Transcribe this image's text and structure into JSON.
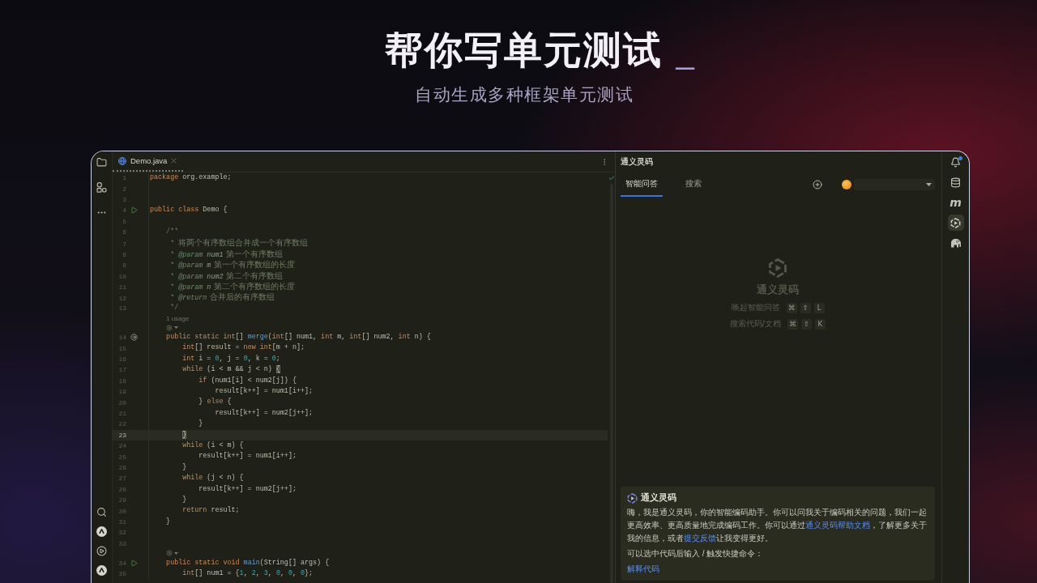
{
  "header": {
    "title": "帮你写单元测试",
    "cursor": "_",
    "subtitle": "自动生成多种框架单元测试"
  },
  "editor": {
    "tabs": [
      {
        "label": "Demo.java",
        "selected": true
      }
    ],
    "lines": [
      {
        "kind": "code",
        "number": "1",
        "current": false,
        "tokens": [
          {
            "kind": "keyword",
            "text": "package"
          },
          {
            "kind": "plain",
            "text": " org.example;"
          }
        ]
      },
      {
        "kind": "code",
        "number": "2",
        "current": false
      },
      {
        "kind": "code",
        "number": "3",
        "current": false
      },
      {
        "kind": "code",
        "number": "4",
        "current": false,
        "run_marker": true,
        "tokens": [
          {
            "kind": "keyword",
            "text": "public class"
          },
          {
            "kind": "plain",
            "text": " Demo {"
          }
        ]
      },
      {
        "kind": "code",
        "number": "5",
        "current": false
      },
      {
        "kind": "code",
        "number": "6",
        "current": false,
        "tokens": [
          {
            "kind": "comment",
            "text": "    /**"
          }
        ]
      },
      {
        "kind": "code",
        "number": "7",
        "current": false,
        "tokens": [
          {
            "kind": "comment",
            "text": "     * "
          },
          {
            "kind": "doc_text",
            "text": "将两个有序数组合并成一个有序数组"
          }
        ]
      },
      {
        "kind": "code",
        "number": "8",
        "current": false,
        "tokens": [
          {
            "kind": "comment",
            "text": "     * "
          },
          {
            "kind": "doctag",
            "text": "@param"
          },
          {
            "kind": "docparam",
            "text": " num1"
          },
          {
            "kind": "doc_text",
            "text": " 第一个有序数组"
          }
        ]
      },
      {
        "kind": "code",
        "number": "9",
        "current": false,
        "tokens": [
          {
            "kind": "comment",
            "text": "     * "
          },
          {
            "kind": "doctag",
            "text": "@param"
          },
          {
            "kind": "docparam",
            "text": " m"
          },
          {
            "kind": "doc_text",
            "text": " 第一个有序数组的长度"
          }
        ]
      },
      {
        "kind": "code",
        "number": "10",
        "current": false,
        "tokens": [
          {
            "kind": "comment",
            "text": "     * "
          },
          {
            "kind": "doctag",
            "text": "@param"
          },
          {
            "kind": "docparam",
            "text": " num2"
          },
          {
            "kind": "doc_text",
            "text": " 第二个有序数组"
          }
        ]
      },
      {
        "kind": "code",
        "number": "11",
        "current": false,
        "tokens": [
          {
            "kind": "comment",
            "text": "     * "
          },
          {
            "kind": "doctag",
            "text": "@param"
          },
          {
            "kind": "docparam",
            "text": " n"
          },
          {
            "kind": "doc_text",
            "text": " 第二个有序数组的长度"
          }
        ]
      },
      {
        "kind": "code",
        "number": "12",
        "current": false,
        "tokens": [
          {
            "kind": "comment",
            "text": "     * "
          },
          {
            "kind": "doctag",
            "text": "@return"
          },
          {
            "kind": "doc_text",
            "text": " 合并后的有序数组"
          }
        ]
      },
      {
        "kind": "code",
        "number": "13",
        "current": false,
        "tokens": [
          {
            "kind": "comment",
            "text": "     */"
          }
        ]
      },
      {
        "kind": "inlay",
        "text": "1 usage"
      },
      {
        "kind": "inlay_icon"
      },
      {
        "kind": "code",
        "number": "14",
        "current": false,
        "at_marker": true,
        "tokens": [
          {
            "kind": "keyword",
            "text": "    public static int"
          },
          {
            "kind": "plain",
            "text": "[] "
          },
          {
            "kind": "method",
            "text": "merge"
          },
          {
            "kind": "plain",
            "text": "("
          },
          {
            "kind": "keyword",
            "text": "int"
          },
          {
            "kind": "plain",
            "text": "[] num1, "
          },
          {
            "kind": "keyword",
            "text": "int"
          },
          {
            "kind": "plain",
            "text": " m, "
          },
          {
            "kind": "keyword",
            "text": "int"
          },
          {
            "kind": "plain",
            "text": "[] num2, "
          },
          {
            "kind": "keyword",
            "text": "int"
          },
          {
            "kind": "plain",
            "text": " n) {"
          }
        ]
      },
      {
        "kind": "code",
        "number": "15",
        "current": false,
        "tokens": [
          {
            "kind": "keyword",
            "text": "        int"
          },
          {
            "kind": "plain",
            "text": "[] result = "
          },
          {
            "kind": "keyword",
            "text": "new int"
          },
          {
            "kind": "plain",
            "text": "[m + n];"
          }
        ]
      },
      {
        "kind": "code",
        "number": "16",
        "current": false,
        "tokens": [
          {
            "kind": "keyword",
            "text": "        int"
          },
          {
            "kind": "plain",
            "text": " i = "
          },
          {
            "kind": "number",
            "text": "0"
          },
          {
            "kind": "plain",
            "text": ", j = "
          },
          {
            "kind": "number",
            "text": "0"
          },
          {
            "kind": "plain",
            "text": ", k = "
          },
          {
            "kind": "number",
            "text": "0"
          },
          {
            "kind": "plain",
            "text": ";"
          }
        ]
      },
      {
        "kind": "code",
        "number": "17",
        "current": false,
        "tokens": [
          {
            "kind": "keyword",
            "text": "        while"
          },
          {
            "kind": "plain",
            "text": " (i < m && j < n) "
          },
          {
            "kind": "match",
            "text": "{"
          }
        ]
      },
      {
        "kind": "code",
        "number": "18",
        "current": false,
        "tokens": [
          {
            "kind": "keyword",
            "text": "            if"
          },
          {
            "kind": "plain",
            "text": " (num1[i] < num2[j]) {"
          }
        ]
      },
      {
        "kind": "code",
        "number": "19",
        "current": false,
        "tokens": [
          {
            "kind": "plain",
            "text": "                result[k++] = num1[i++];"
          }
        ]
      },
      {
        "kind": "code",
        "number": "20",
        "current": false,
        "tokens": [
          {
            "kind": "plain",
            "text": "            } "
          },
          {
            "kind": "keyword",
            "text": "else"
          },
          {
            "kind": "plain",
            "text": " {"
          }
        ]
      },
      {
        "kind": "code",
        "number": "21",
        "current": false,
        "tokens": [
          {
            "kind": "plain",
            "text": "                result[k++] = num2[j++];"
          }
        ]
      },
      {
        "kind": "code",
        "number": "22",
        "current": false,
        "tokens": [
          {
            "kind": "plain",
            "text": "            }"
          }
        ]
      },
      {
        "kind": "code",
        "number": "23",
        "current": true,
        "tokens": [
          {
            "kind": "match",
            "text": "        }"
          }
        ]
      },
      {
        "kind": "code",
        "number": "24",
        "current": false,
        "tokens": [
          {
            "kind": "keyword",
            "text": "        while"
          },
          {
            "kind": "plain",
            "text": " (i < m) {"
          }
        ]
      },
      {
        "kind": "code",
        "number": "25",
        "current": false,
        "tokens": [
          {
            "kind": "plain",
            "text": "            result[k++] = num1[i++];"
          }
        ]
      },
      {
        "kind": "code",
        "number": "26",
        "current": false,
        "tokens": [
          {
            "kind": "plain",
            "text": "        }"
          }
        ]
      },
      {
        "kind": "code",
        "number": "27",
        "current": false,
        "tokens": [
          {
            "kind": "keyword",
            "text": "        while"
          },
          {
            "kind": "plain",
            "text": " (j < n) {"
          }
        ]
      },
      {
        "kind": "code",
        "number": "28",
        "current": false,
        "tokens": [
          {
            "kind": "plain",
            "text": "            result[k++] = num2[j++];"
          }
        ]
      },
      {
        "kind": "code",
        "number": "29",
        "current": false,
        "tokens": [
          {
            "kind": "plain",
            "text": "        }"
          }
        ]
      },
      {
        "kind": "code",
        "number": "30",
        "current": false,
        "tokens": [
          {
            "kind": "keyword",
            "text": "        return"
          },
          {
            "kind": "plain",
            "text": " result;"
          }
        ]
      },
      {
        "kind": "code",
        "number": "31",
        "current": false,
        "tokens": [
          {
            "kind": "plain",
            "text": "    }"
          }
        ]
      },
      {
        "kind": "code",
        "number": "32",
        "current": false
      },
      {
        "kind": "code",
        "number": "33",
        "current": false
      },
      {
        "kind": "inlay_icon"
      },
      {
        "kind": "code",
        "number": "34",
        "current": false,
        "run_marker": true,
        "tokens": [
          {
            "kind": "keyword",
            "text": "    public static void"
          },
          {
            "kind": "method",
            "text": " main"
          },
          {
            "kind": "plain",
            "text": "(String[] args) {"
          }
        ]
      },
      {
        "kind": "code",
        "number": "35",
        "current": false,
        "tokens": [
          {
            "kind": "keyword",
            "text": "        int"
          },
          {
            "kind": "plain",
            "text": "[] num1 = {"
          },
          {
            "kind": "number",
            "text": "1"
          },
          {
            "kind": "plain",
            "text": ", "
          },
          {
            "kind": "number",
            "text": "2"
          },
          {
            "kind": "plain",
            "text": ", "
          },
          {
            "kind": "number",
            "text": "3"
          },
          {
            "kind": "plain",
            "text": ", "
          },
          {
            "kind": "number",
            "text": "0"
          },
          {
            "kind": "plain",
            "text": ", "
          },
          {
            "kind": "number",
            "text": "0"
          },
          {
            "kind": "plain",
            "text": ", "
          },
          {
            "kind": "number",
            "text": "0"
          },
          {
            "kind": "plain",
            "text": "};"
          }
        ]
      }
    ]
  },
  "assistant": {
    "title": "通义灵码",
    "tabs": [
      {
        "label": "智能问答",
        "selected": true
      },
      {
        "label": "搜索",
        "selected": false
      }
    ],
    "welcome": {
      "name": "通义灵码",
      "shortcuts": [
        {
          "label": "唤起智能问答",
          "keys": [
            "⌘",
            "⇧",
            "L"
          ]
        },
        {
          "label": "搜索代码/文档",
          "keys": [
            "⌘",
            "⇧",
            "K"
          ]
        }
      ]
    },
    "message": {
      "sender": "通义灵码",
      "paragraphs": [
        {
          "segments": [
            {
              "kind": "text",
              "text": "嗨，我是通义灵码，你的智能编码助手。你可以问我关于编码相关的问题，我们一起更高效率、更高质量地完成编码工作。你可以通过"
            },
            {
              "kind": "link",
              "text": "通义灵码帮助文档"
            },
            {
              "kind": "text",
              "text": "，了解更多关于我的信息，或者"
            },
            {
              "kind": "link",
              "text": "提交反馈"
            },
            {
              "kind": "text",
              "text": "让我变得更好。"
            }
          ]
        },
        {
          "segments": [
            {
              "kind": "text",
              "text": "可以选中代码后输入 / 触发快捷命令："
            }
          ]
        }
      ],
      "commands": [
        {
          "label": "解释代码"
        }
      ]
    }
  },
  "right_toolbar": [
    {
      "kind": "bell",
      "selected": false
    },
    {
      "kind": "database",
      "selected": false
    },
    {
      "kind": "letter",
      "text": "m",
      "selected": false
    },
    {
      "kind": "logo",
      "selected": true
    },
    {
      "kind": "elephant",
      "selected": false
    }
  ]
}
